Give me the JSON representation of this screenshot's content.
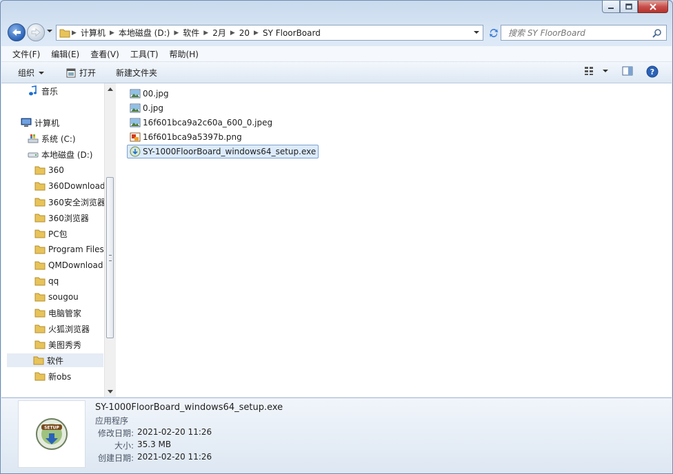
{
  "window": {
    "caption_buttons": [
      "minimize",
      "maximize",
      "close"
    ]
  },
  "address_bar": {
    "breadcrumbs": [
      "计算机",
      "本地磁盘 (D:)",
      "软件",
      "2月",
      "20",
      "SY FloorBoard"
    ],
    "search_placeholder": "搜索 SY FloorBoard"
  },
  "menubar": {
    "items": [
      "文件(F)",
      "编辑(E)",
      "查看(V)",
      "工具(T)",
      "帮助(H)"
    ]
  },
  "toolbar": {
    "organize": "组织",
    "open": "打开",
    "new_folder": "新建文件夹"
  },
  "nav_pane": {
    "music": "音乐",
    "computer": "计算机",
    "drive_c": "系统 (C:)",
    "drive_d": "本地磁盘 (D:)",
    "folders": [
      "360",
      "360Download",
      "360安全浏览器",
      "360浏览器",
      "PC包",
      "Program Files",
      "QMDownload",
      "qq",
      "sougou",
      "电脑管家",
      "火狐浏览器",
      "美图秀秀",
      "软件",
      "新obs"
    ],
    "selected_folder": "软件"
  },
  "files": [
    {
      "name": "00.jpg",
      "icon": "image-file-icon"
    },
    {
      "name": "0.jpg",
      "icon": "image-file-icon"
    },
    {
      "name": "16f601bca9a2c60a_600_0.jpeg",
      "icon": "image-file-icon"
    },
    {
      "name": "16f601bca9a5397b.png",
      "icon": "png-file-icon"
    },
    {
      "name": "SY-1000FloorBoard_windows64_setup.exe",
      "icon": "setup-exe-icon",
      "selected": true
    }
  ],
  "details": {
    "name": "SY-1000FloorBoard_windows64_setup.exe",
    "type": "应用程序",
    "modified_label": "修改日期:",
    "modified_value": "2021-02-20 11:26",
    "size_label": "大小:",
    "size_value": "35.3 MB",
    "created_label": "创建日期:",
    "created_value": "2021-02-20 11:26",
    "thumb_label": "SETUP"
  },
  "colors": {
    "selection_bg": "#dcebfc",
    "selection_border": "#7da2ce",
    "folder": "#e8c35a",
    "close_button": "#c75050"
  }
}
